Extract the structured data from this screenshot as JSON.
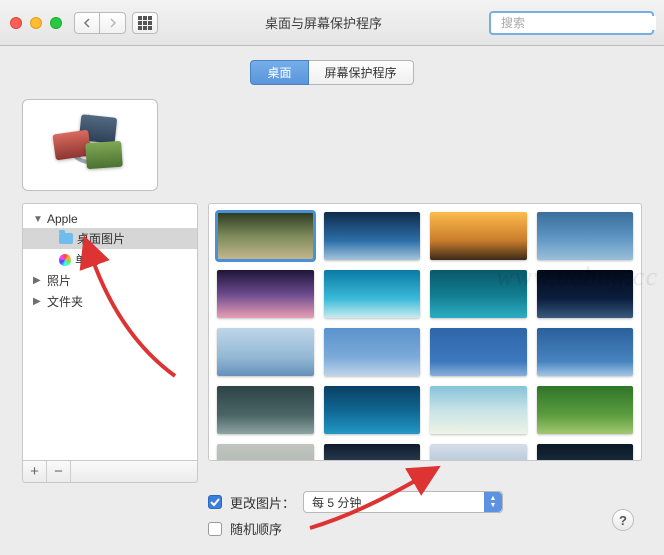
{
  "window": {
    "title": "桌面与屏幕保护程序",
    "search_placeholder": "搜索"
  },
  "tabs": [
    {
      "label": "桌面",
      "active": true
    },
    {
      "label": "屏幕保护程序",
      "active": false
    }
  ],
  "sidebar": {
    "items": [
      {
        "label": "Apple",
        "level": 0,
        "expanded": true
      },
      {
        "label": "桌面图片",
        "level": 1,
        "selected": true,
        "icon": "folder"
      },
      {
        "label": "单色",
        "level": 1,
        "icon": "colors"
      },
      {
        "label": "照片",
        "level": 0,
        "expanded": false
      },
      {
        "label": "文件夹",
        "level": 0,
        "expanded": false
      }
    ],
    "add_label": "+",
    "remove_label": "−"
  },
  "thumbnails": [
    {
      "g": "linear-gradient(#2a3a1e,#7e8a5b 50%,#c5b98e)",
      "selected": true
    },
    {
      "g": "linear-gradient(#0e2b4a,#2d6fa8 60%,#a4c5dc)"
    },
    {
      "g": "linear-gradient(#fcbb4c,#c97c2c 60%,#3a2a18)"
    },
    {
      "g": "linear-gradient(#3b6e9b,#5a92c0 50%,#9abfda)"
    },
    {
      "g": "linear-gradient(#1d1538,#6a4a8d 50%,#e99fb4)"
    },
    {
      "g": "linear-gradient(#0a7aa5,#3bbad8 60%,#c9ecef)"
    },
    {
      "g": "linear-gradient(#0a586b,#127b8e 50%,#2cadc2)"
    },
    {
      "g": "linear-gradient(#020817,#0b1e3e 60%,#3a5a7d)"
    },
    {
      "g": "linear-gradient(#bfd6e8,#94b9d6 60%,#6691ba)"
    },
    {
      "g": "linear-gradient(#5a93cd,#7ba9d8 60%,#bfd5e8)"
    },
    {
      "g": "linear-gradient(#2e66a8,#3e79bd 70%,#88b0da)"
    },
    {
      "g": "linear-gradient(#2a5f9a,#4884c0 70%,#a4c6e4)"
    },
    {
      "g": "linear-gradient(#2d4445,#4a6465 60%,#8ea4a1)"
    },
    {
      "g": "linear-gradient(#0a4064,#0e6691 50%,#2299c4)"
    },
    {
      "g": "linear-gradient(#86c3da,#c7e3e6 50%,#eef3e6)"
    },
    {
      "g": "linear-gradient(#2f7529,#5a9c3e 60%,#a2c871)"
    },
    {
      "g": "linear-gradient(#c2c5bf,#adb5b0 60%,#8a9693)"
    },
    {
      "g": "linear-gradient(#0f1a2b,#30465c 50%,#97a9b7)"
    },
    {
      "g": "linear-gradient(#d7dee8,#a7bdd5 60%,#6a8db5)"
    },
    {
      "g": "linear-gradient(#0b1725,#20364c 60%,#4e6b82)"
    }
  ],
  "options": {
    "change_label": "更改图片：",
    "change_checked": true,
    "interval_selected": "每 5 分钟",
    "random_label": "随机顺序",
    "random_checked": false
  },
  "watermark": "www.ucbug.cc"
}
